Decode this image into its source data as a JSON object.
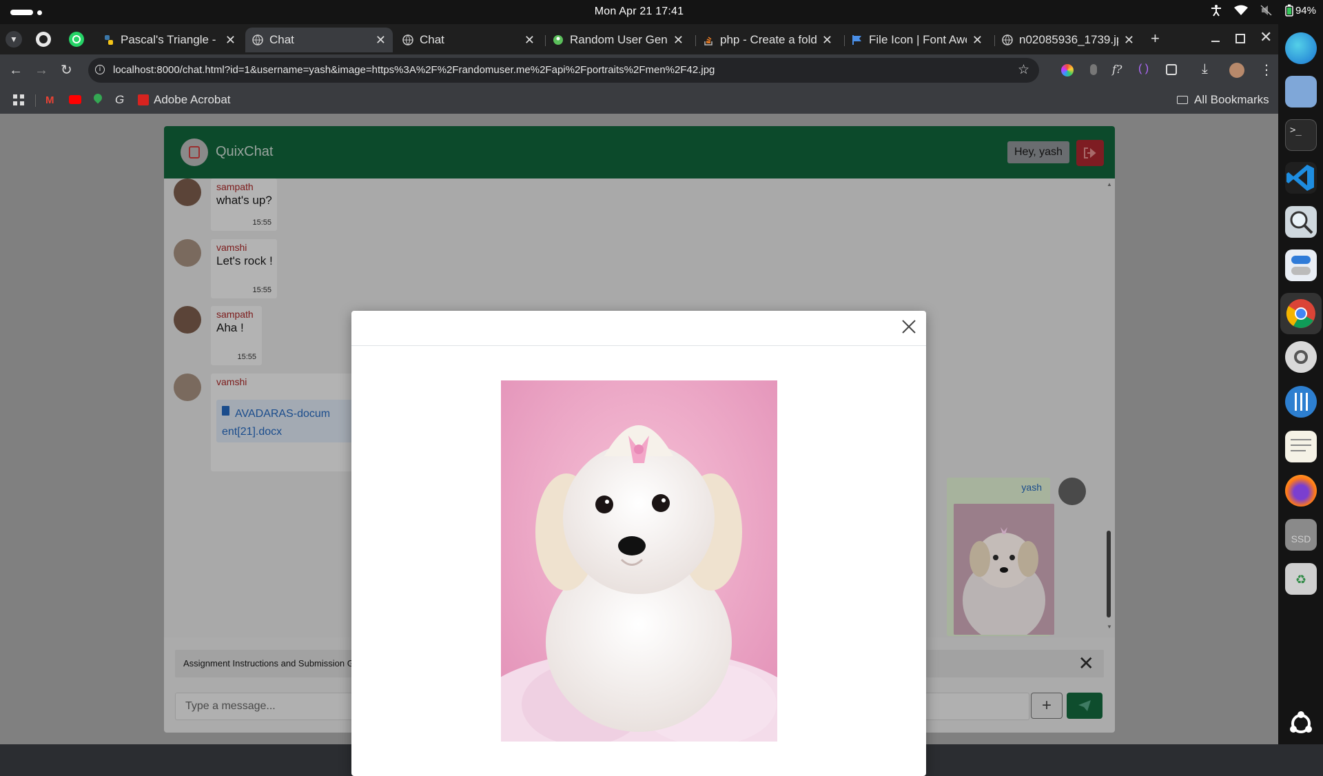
{
  "os": {
    "clock": "Mon Apr 21  17:41",
    "battery": "94%"
  },
  "browser": {
    "tabs": [
      {
        "label": "Pascal's Triangle - l",
        "icon": "python-icon"
      },
      {
        "label": "Chat",
        "icon": "globe-icon",
        "active": true
      },
      {
        "label": "Chat",
        "icon": "globe-icon"
      },
      {
        "label": "Random User Gene",
        "icon": "random-user-icon"
      },
      {
        "label": "php - Create a fold",
        "icon": "stackoverflow-icon"
      },
      {
        "label": "File Icon | Font Awe",
        "icon": "flag-icon"
      },
      {
        "label": "n02085936_1739.jp",
        "icon": "globe-icon"
      }
    ],
    "url": "localhost:8000/chat.html?id=1&username=yash&image=https%3A%2F%2Frandomuser.me%2Fapi%2Fportraits%2Fmen%2F42.jpg",
    "bookmarks": {
      "adobe": "Adobe Acrobat",
      "all": "All Bookmarks"
    }
  },
  "chat": {
    "brand": "QuixChat",
    "greeting": "Hey, yash",
    "messages": [
      {
        "user": "sampath",
        "text": "what's up?",
        "time": "15:55"
      },
      {
        "user": "vamshi",
        "text": "Let's rock !",
        "time": "15:55"
      },
      {
        "user": "sampath",
        "text": "Aha !",
        "time": "15:55"
      },
      {
        "user": "vamshi",
        "file": "AVADARAS-document[21].docx"
      }
    ],
    "own_message": {
      "user": "yash"
    },
    "attachment": "Assignment Instructions and Submission Guidelines.pdf",
    "compose_placeholder": "Type a message..."
  },
  "dock": {
    "ssd_label": "SSD"
  },
  "colors": {
    "header_green": "#0c4a2b",
    "danger": "#7e1c22",
    "link_blue": "#1a4c8c"
  }
}
